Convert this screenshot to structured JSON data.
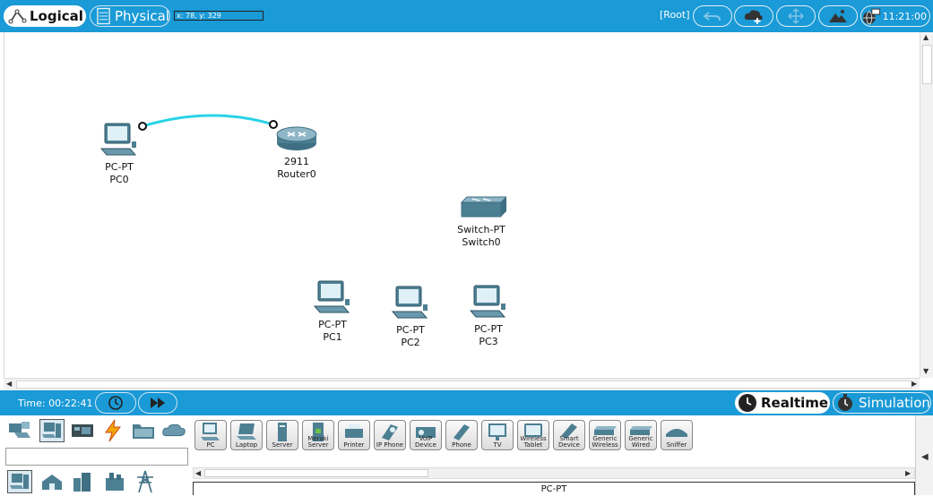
{
  "toolbar": {
    "logical_label": "Logical",
    "physical_label": "Physical",
    "cursor_coords": "x: 78, y: 329",
    "root_label": "[Root]",
    "clock": "11:21:00"
  },
  "devices": [
    {
      "model": "PC-PT",
      "name": "PC0",
      "icon": "pc-icon"
    },
    {
      "model": "2911",
      "name": "Router0",
      "icon": "router-icon"
    },
    {
      "model": "Switch-PT",
      "name": "Switch0",
      "icon": "switch-icon"
    },
    {
      "model": "PC-PT",
      "name": "PC1",
      "icon": "pc-icon"
    },
    {
      "model": "PC-PT",
      "name": "PC2",
      "icon": "pc-icon"
    },
    {
      "model": "PC-PT",
      "name": "PC3",
      "icon": "pc-icon"
    }
  ],
  "link_color": "#29d3e6",
  "status": {
    "time": "Time: 00:22:41",
    "realtime_label": "Realtime",
    "simulation_label": "Simulation"
  },
  "device_types": [
    {
      "label": "PC"
    },
    {
      "label": "Laptop"
    },
    {
      "label": "Server"
    },
    {
      "label": "Meraki Server"
    },
    {
      "label": "Printer"
    },
    {
      "label": "IP Phone"
    },
    {
      "label": "VoIP Device"
    },
    {
      "label": "Phone"
    },
    {
      "label": "TV"
    },
    {
      "label": "Wireless Tablet"
    },
    {
      "label": "Smart Device"
    },
    {
      "label": "Generic Wireless"
    },
    {
      "label": "Generic Wired"
    },
    {
      "label": "Sniffer"
    }
  ],
  "selected_device_type": "PC-PT",
  "colors": {
    "accent": "#1a9ad6"
  }
}
